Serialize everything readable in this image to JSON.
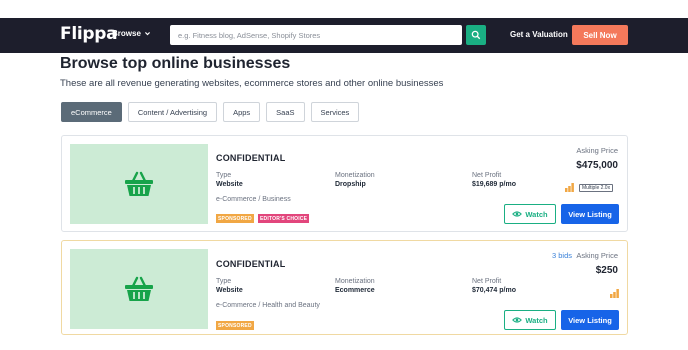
{
  "navbar": {
    "logo": "Flippa",
    "browse_label": "Browse",
    "search_placeholder": "e.g. Fitness blog, AdSense, Shopify Stores",
    "valuation_label": "Get a Valuation",
    "sell_label": "Sell Now"
  },
  "page": {
    "title": "Browse top online businesses",
    "subtitle": "These are all revenue generating websites, ecommerce stores and other online businesses"
  },
  "tabs": [
    {
      "label": "eCommerce",
      "active": true
    },
    {
      "label": "Content / Advertising",
      "active": false
    },
    {
      "label": "Apps",
      "active": false
    },
    {
      "label": "SaaS",
      "active": false
    },
    {
      "label": "Services",
      "active": false
    }
  ],
  "listings": [
    {
      "title": "CONFIDENTIAL",
      "type_label": "Type",
      "type_value": "Website",
      "monetization_label": "Monetization",
      "monetization_value": "Dropship",
      "net_profit_label": "Net Profit",
      "net_profit_value": "$19,689 p/mo",
      "category": "e-Commerce / Business",
      "badges": [
        "SPONSORED",
        "EDITOR'S CHOICE"
      ],
      "asking_label": "Asking Price",
      "price": "$475,000",
      "multiple": "Multiple 2.0x",
      "watch_label": "Watch",
      "view_label": "View Listing",
      "icon": "shopping-basket-icon"
    },
    {
      "title": "CONFIDENTIAL",
      "type_label": "Type",
      "type_value": "Website",
      "monetization_label": "Monetization",
      "monetization_value": "Ecommerce",
      "net_profit_label": "Net Profit",
      "net_profit_value": "$70,474 p/mo",
      "category": "e-Commerce / Health and Beauty",
      "badges": [
        "SPONSORED"
      ],
      "bids": "3 bids",
      "asking_label": "Asking Price",
      "price": "$250",
      "watch_label": "Watch",
      "view_label": "View Listing",
      "icon": "shopping-basket-icon"
    }
  ],
  "colors": {
    "navbar_bg": "#1d1e2c",
    "accent_green": "#1aaf83",
    "sell_orange": "#f4795b",
    "view_blue": "#1764e8",
    "thumb_green": "#ccebd5"
  }
}
